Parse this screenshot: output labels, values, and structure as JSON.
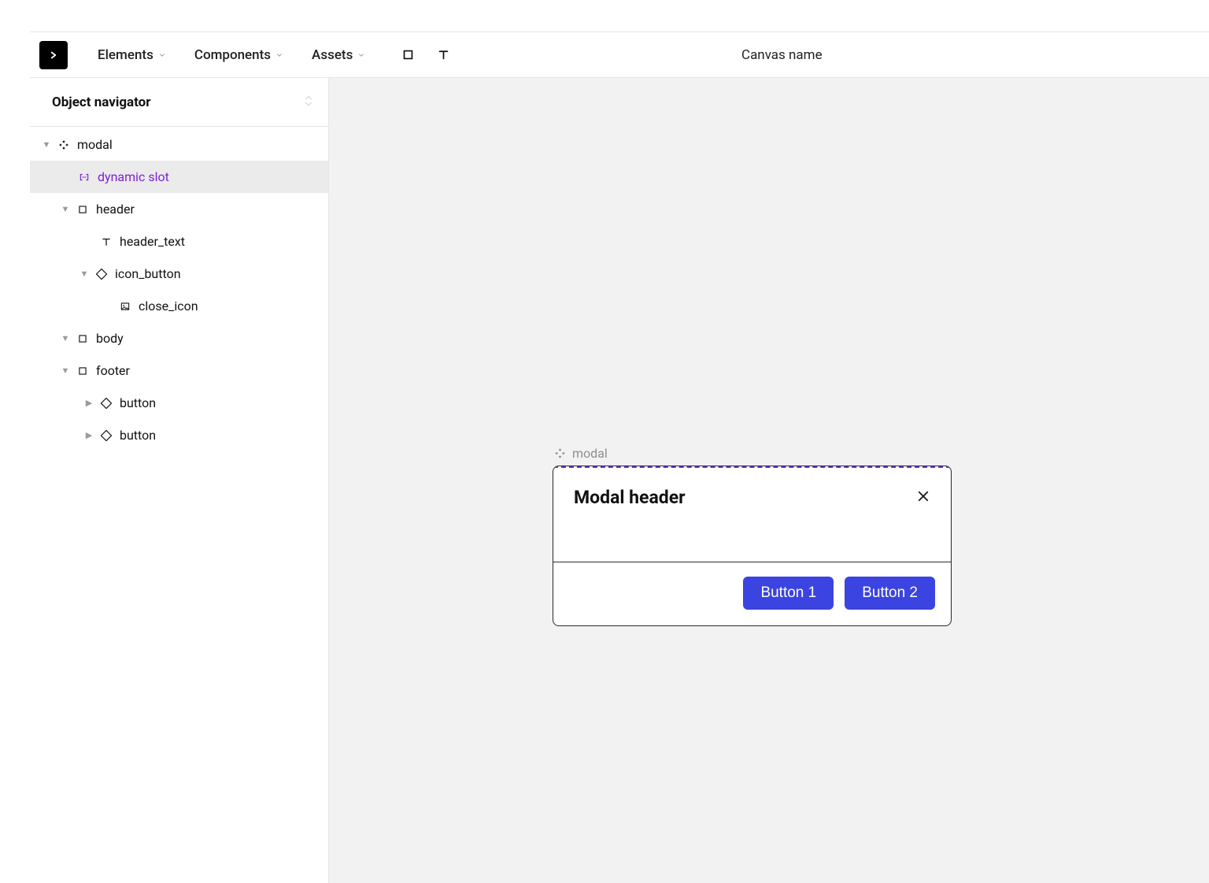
{
  "toolbar": {
    "menu": {
      "elements": "Elements",
      "components": "Components",
      "assets": "Assets"
    },
    "canvas_name": "Canvas name"
  },
  "sidebar": {
    "title": "Object navigator"
  },
  "tree": {
    "modal": "modal",
    "dynamic_slot": "dynamic slot",
    "header": "header",
    "header_text": "header_text",
    "icon_button": "icon_button",
    "close_icon": "close_icon",
    "body": "body",
    "footer": "footer",
    "button1": "button",
    "button2": "button"
  },
  "canvas": {
    "tag": "modal",
    "modal": {
      "header_text": "Modal header",
      "button1": "Button 1",
      "button2": "Button 2"
    }
  },
  "colors": {
    "accent": "#3b44e0",
    "slot": "#6c2bd9",
    "canvas_bg": "#f2f2f2"
  }
}
